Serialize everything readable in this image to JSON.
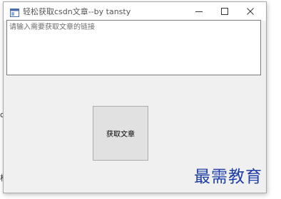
{
  "background": {
    "fragment_1": "d",
    "fragment_2": "析"
  },
  "window": {
    "title": "轻松获取csdn文章--by tansty",
    "icon": "app-window-icon",
    "controls": {
      "minimize": "minimize-icon",
      "maximize": "maximize-icon",
      "close": "close-icon"
    }
  },
  "url_input": {
    "placeholder": "请输入需要获取文章的链接",
    "value": ""
  },
  "fetch_button": {
    "label": "获取文章"
  },
  "watermark": {
    "text": "最需教育",
    "color": "#1e3ea8"
  }
}
